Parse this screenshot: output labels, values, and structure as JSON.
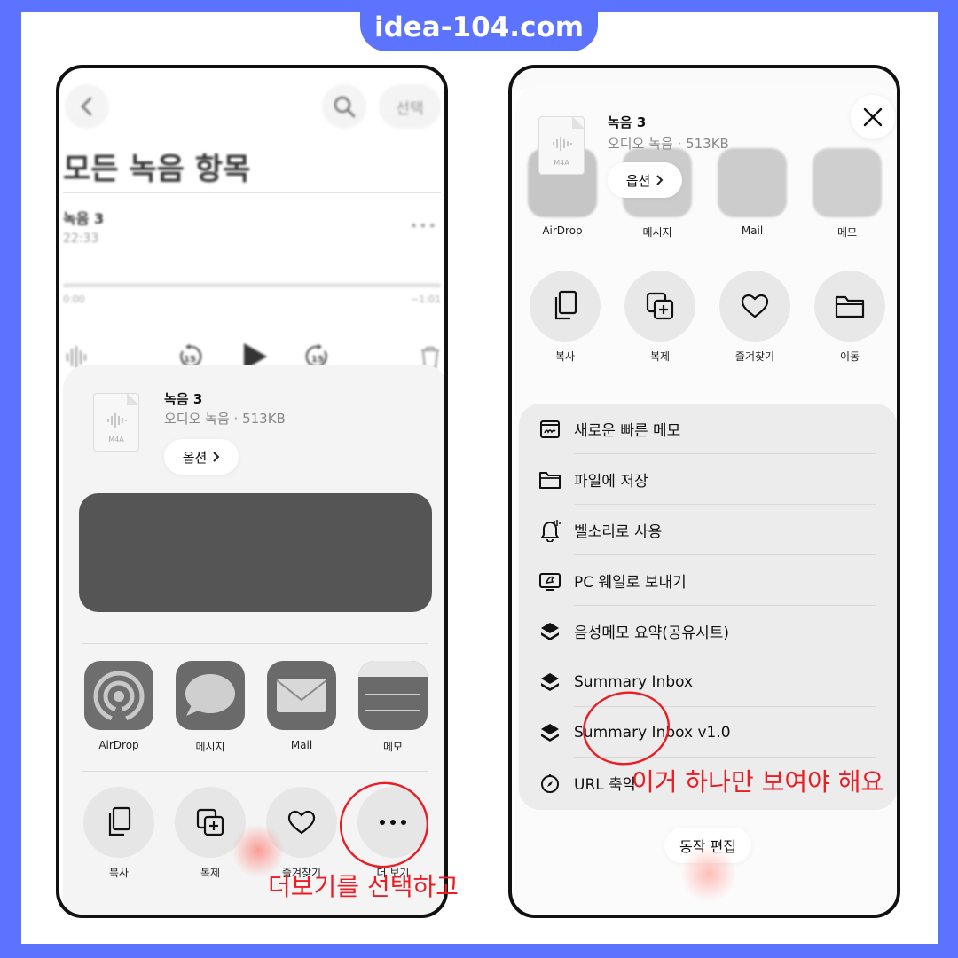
{
  "site": "idea-104.com",
  "left": {
    "back_icon": "chevron-left-icon",
    "search_icon": "search-icon",
    "select_label": "선택",
    "page_title": "모든 녹음 항목",
    "recording": {
      "name": "녹음 3",
      "duration": "22:33",
      "time_start": "0:00",
      "time_end": "−1:01"
    },
    "controls": {
      "skip_back": "15",
      "skip_fwd": "15"
    },
    "file": {
      "name": "녹음 3",
      "meta": "오디오 녹음 · 513KB",
      "badge": "M4A",
      "options_label": "옵션"
    },
    "apps": [
      {
        "label": "AirDrop"
      },
      {
        "label": "메시지"
      },
      {
        "label": "Mail"
      },
      {
        "label": "메모"
      }
    ],
    "actions": [
      {
        "label": "복사",
        "icon": "copy-icon"
      },
      {
        "label": "복제",
        "icon": "duplicate-icon"
      },
      {
        "label": "즐겨찾기",
        "icon": "heart-icon"
      },
      {
        "label": "더 보기",
        "icon": "more-icon"
      }
    ],
    "annotation": "더보기를 선택하고"
  },
  "right": {
    "close_icon": "close-icon",
    "file": {
      "name": "녹음 3",
      "meta": "오디오 녹음 · 513KB",
      "badge": "M4A",
      "options_label": "옵션"
    },
    "apps": [
      {
        "label": "AirDrop"
      },
      {
        "label": "메시지"
      },
      {
        "label": "Mail"
      },
      {
        "label": "메모"
      }
    ],
    "actions": [
      {
        "label": "복사",
        "icon": "copy-icon"
      },
      {
        "label": "복제",
        "icon": "duplicate-icon"
      },
      {
        "label": "즐겨찾기",
        "icon": "heart-icon"
      },
      {
        "label": "이동",
        "icon": "folder-icon"
      }
    ],
    "menu": [
      {
        "label": "새로운 빠른 메모",
        "icon": "quick-note-icon"
      },
      {
        "label": "파일에 저장",
        "icon": "folder-icon"
      },
      {
        "label": "벨소리로 사용",
        "icon": "bell-icon"
      },
      {
        "label": "PC 웨일로 보내기",
        "icon": "whale-icon"
      },
      {
        "label": "음성메모 요약(공유시트)",
        "icon": "shortcuts-icon"
      },
      {
        "label": "Summary Inbox",
        "icon": "shortcuts-icon"
      },
      {
        "label": "Summary Inbox v1.0",
        "icon": "shortcuts-icon"
      },
      {
        "label": "URL 축약",
        "icon": "compass-icon"
      }
    ],
    "edit_label": "동작 편집",
    "annotation": "이거 하나만 보여야 해요"
  },
  "colors": {
    "background": "#5b73ff",
    "annotation": "#ec1c24"
  }
}
